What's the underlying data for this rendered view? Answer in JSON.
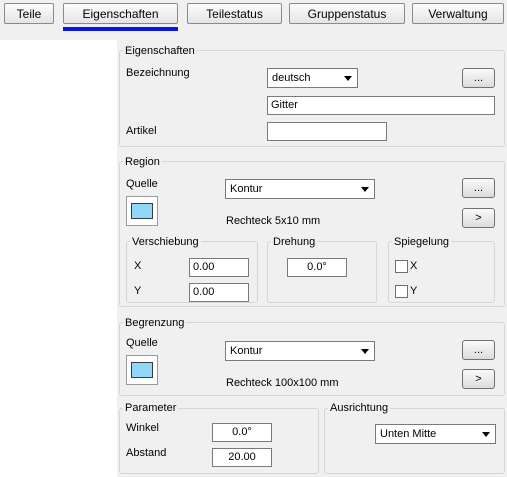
{
  "tabs": [
    "Teile",
    "Eigenschaften",
    "Teilestatus",
    "Gruppenstatus",
    "Verwaltung"
  ],
  "eigenschaften": {
    "title": "Eigenschaften",
    "bezeichnung_label": "Bezeichnung",
    "language": "deutsch",
    "ellipsis": "...",
    "bezeichnung_value": "Gitter",
    "artikel_label": "Artikel",
    "artikel_value": ""
  },
  "region": {
    "title": "Region",
    "quelle_label": "Quelle",
    "quelle_value": "Kontur",
    "ellipsis": "...",
    "description": "Rechteck 5x10 mm",
    "next": ">",
    "verschiebung": {
      "title": "Verschiebung",
      "x_label": "X",
      "x_value": "0.00",
      "y_label": "Y",
      "y_value": "0.00"
    },
    "drehung": {
      "title": "Drehung",
      "value": "0.0°"
    },
    "spiegelung": {
      "title": "Spiegelung",
      "x_label": "X",
      "y_label": "Y"
    }
  },
  "begrenzung": {
    "title": "Begrenzung",
    "quelle_label": "Quelle",
    "quelle_value": "Kontur",
    "ellipsis": "...",
    "description": "Rechteck 100x100 mm",
    "next": ">"
  },
  "parameter": {
    "title": "Parameter",
    "winkel_label": "Winkel",
    "winkel_value": "0.0°",
    "abstand_label": "Abstand",
    "abstand_value": "20.00"
  },
  "ausrichtung": {
    "title": "Ausrichtung",
    "value": "Unten Mitte"
  },
  "colors": {
    "tab_underline": "#0a14dc",
    "swatch_fill": "#8fd8f8"
  }
}
